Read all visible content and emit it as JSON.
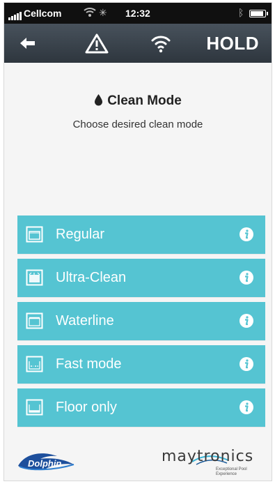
{
  "status_bar": {
    "carrier": "Cellcom",
    "time": "12:32"
  },
  "nav": {
    "back_icon": "arrow-left-icon",
    "warning_icon": "warning-triangle-icon",
    "wifi_icon": "wifi-icon",
    "hold_label": "HOLD"
  },
  "header": {
    "title": "Clean Mode",
    "subtitle": "Choose desired clean mode"
  },
  "modes": [
    {
      "label": "Regular",
      "icon": "pool-regular-icon"
    },
    {
      "label": "Ultra-Clean",
      "icon": "pool-ultra-clean-icon"
    },
    {
      "label": "Waterline",
      "icon": "pool-waterline-icon"
    },
    {
      "label": "Fast mode",
      "icon": "pool-fast-mode-icon"
    },
    {
      "label": "Floor only",
      "icon": "pool-floor-only-icon"
    }
  ],
  "footer": {
    "left_logo": "Dolphin",
    "right_logo": "maytronics",
    "right_tagline": "Exceptional Pool Experience"
  },
  "colors": {
    "accent": "#55c4d2",
    "navbar": "#3a434c",
    "background": "#f5f5f5"
  }
}
